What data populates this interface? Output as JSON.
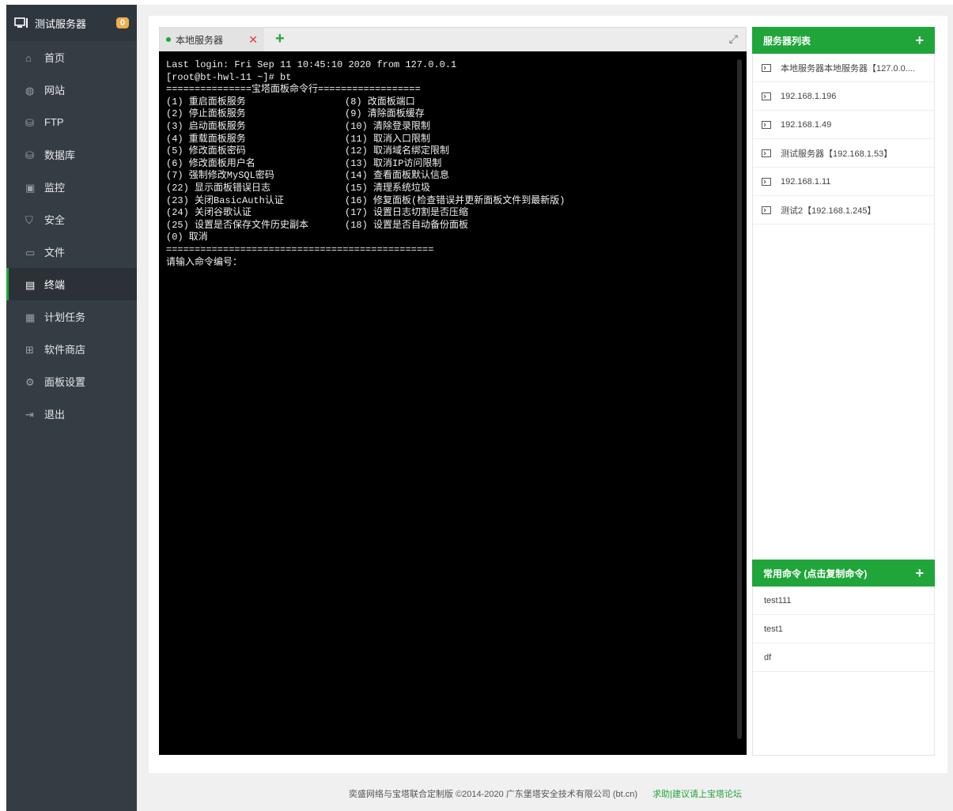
{
  "sidebar": {
    "server_title": "测试服务器",
    "badge": "0",
    "items": [
      {
        "label": "首页",
        "icon": "home-icon"
      },
      {
        "label": "网站",
        "icon": "globe-icon"
      },
      {
        "label": "FTP",
        "icon": "ftp-icon"
      },
      {
        "label": "数据库",
        "icon": "database-icon"
      },
      {
        "label": "监控",
        "icon": "monitor-icon"
      },
      {
        "label": "安全",
        "icon": "shield-icon"
      },
      {
        "label": "文件",
        "icon": "folder-icon"
      },
      {
        "label": "终端",
        "icon": "terminal-icon"
      },
      {
        "label": "计划任务",
        "icon": "calendar-icon"
      },
      {
        "label": "软件商店",
        "icon": "apps-icon"
      },
      {
        "label": "面板设置",
        "icon": "gear-icon"
      },
      {
        "label": "退出",
        "icon": "logout-icon"
      }
    ],
    "active_item": "终端"
  },
  "terminal": {
    "tab_label": "本地服务器",
    "lines_full": [
      "Last login: Fri Sep 11 10:45:10 2020 from 127.0.0.1",
      "[root@bt-hwl-11 ~]# bt",
      "===============宝塔面板命令行=================="
    ],
    "menu": [
      [
        "(1) 重启面板服务",
        "(8) 改面板端口"
      ],
      [
        "(2) 停止面板服务",
        "(9) 清除面板缓存"
      ],
      [
        "(3) 启动面板服务",
        "(10) 清除登录限制"
      ],
      [
        "(4) 重载面板服务",
        "(11) 取消入口限制"
      ],
      [
        "(5) 修改面板密码",
        "(12) 取消域名绑定限制"
      ],
      [
        "(6) 修改面板用户名",
        "(13) 取消IP访问限制"
      ],
      [
        "(7) 强制修改MySQL密码",
        "(14) 查看面板默认信息"
      ],
      [
        "(22) 显示面板错误日志",
        "(15) 清理系统垃圾"
      ],
      [
        "(23) 关闭BasicAuth认证",
        "(16) 修复面板(检查错误并更新面板文件到最新版)"
      ],
      [
        "(24) 关闭谷歌认证",
        "(17) 设置日志切割是否压缩"
      ],
      [
        "(25) 设置是否保存文件历史副本",
        "(18) 设置是否自动备份面板"
      ]
    ],
    "tail": [
      "(0) 取消",
      "===============================================",
      "请输入命令编号："
    ]
  },
  "server_list": {
    "title": "服务器列表",
    "items": [
      "本地服务器本地服务器【127.0.0....",
      "192.168.1.196",
      "192.168.1.49",
      "测试服务器【192.168.1.53】",
      "192.168.1.11",
      "测试2【192.168.1.245】"
    ]
  },
  "commands": {
    "title": "常用命令 (点击复制命令)",
    "items": [
      "test111",
      "test1",
      "df"
    ]
  },
  "footer": {
    "copyright": "奕盛网络与宝塔联合定制版 ©2014-2020 广东堡塔安全技术有限公司 (bt.cn)",
    "forum_link": "求助|建议请上宝塔论坛"
  },
  "colors": {
    "accent": "#20a53a",
    "sidebar": "#353d44",
    "badge": "#f0ad4e"
  }
}
